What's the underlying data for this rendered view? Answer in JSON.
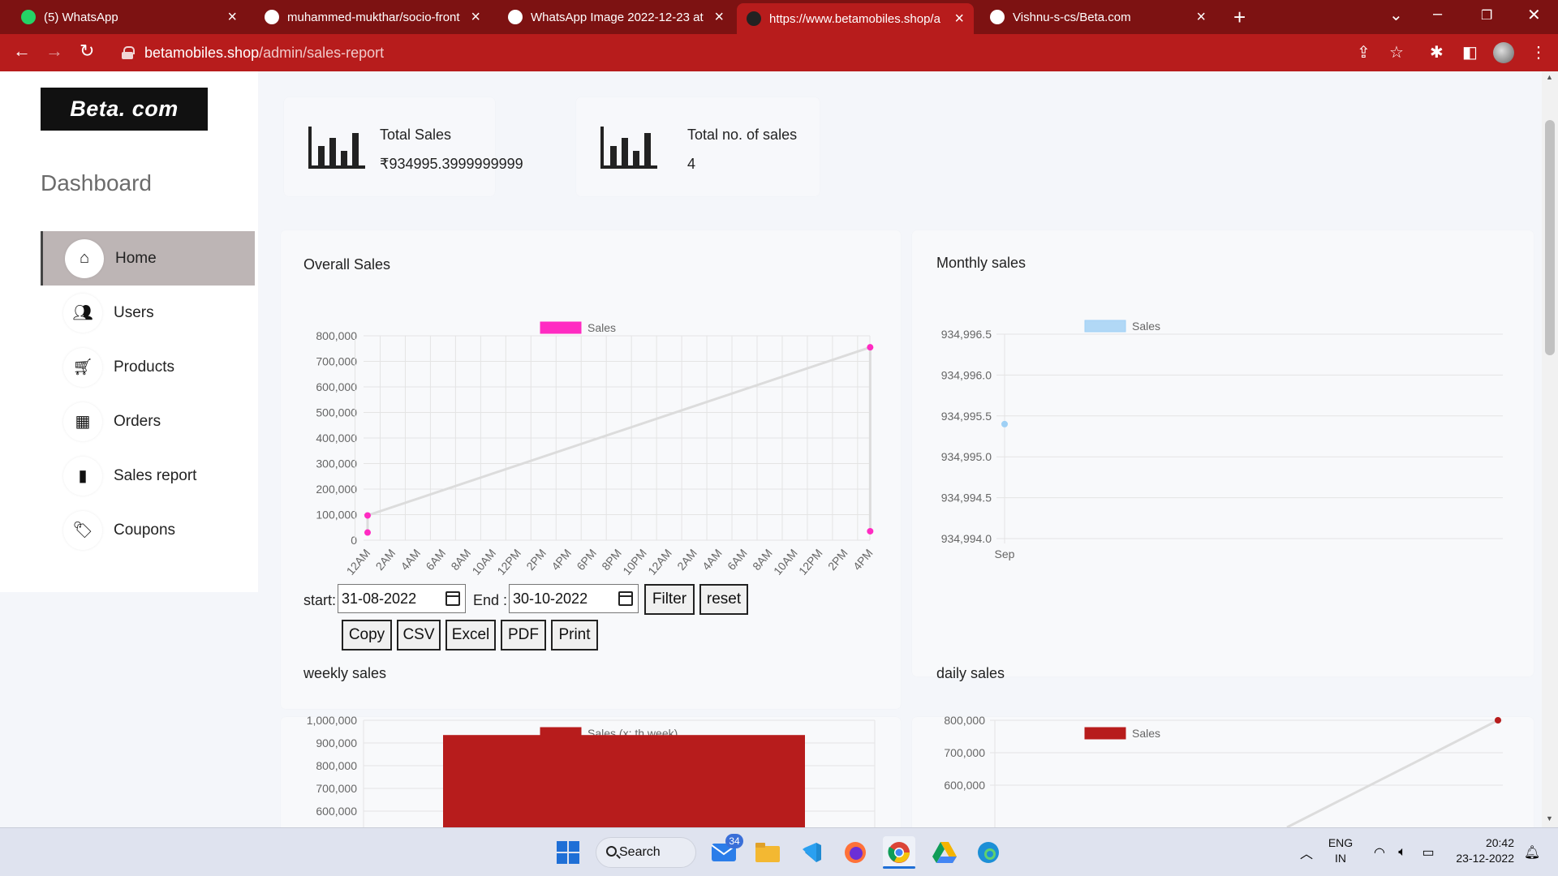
{
  "browser": {
    "tabs": [
      {
        "label": "(5) WhatsApp",
        "favicon_color": "#25d366"
      },
      {
        "label": "muhammed-mukthar/socio-front",
        "favicon_color": "#ffffff"
      },
      {
        "label": "WhatsApp Image 2022-12-23 at",
        "favicon_color": "#ffffff"
      },
      {
        "label": "https://www.betamobiles.shop/a",
        "favicon_color": "#222222"
      },
      {
        "label": "Vishnu-s-cs/Beta.com",
        "favicon_color": "#ffffff"
      }
    ],
    "active_tab_index": 3,
    "address": {
      "host": "betamobiles.shop",
      "path": "/admin/sales-report"
    }
  },
  "sidebar": {
    "logo": "Beta. com",
    "title": "Dashboard",
    "items": [
      {
        "label": "Home",
        "icon": "home-icon",
        "active": true
      },
      {
        "label": "Users",
        "icon": "users-icon",
        "active": false
      },
      {
        "label": "Products",
        "icon": "cart-icon",
        "active": false
      },
      {
        "label": "Orders",
        "icon": "table-icon",
        "active": false
      },
      {
        "label": "Sales report",
        "icon": "bar-chart-icon",
        "active": false
      },
      {
        "label": "Coupons",
        "icon": "tag-icon",
        "active": false
      }
    ]
  },
  "stats": {
    "total_sales_label": "Total Sales",
    "total_sales_value": "₹934995.3999999999",
    "total_count_label": "Total no. of sales",
    "total_count_value": "4"
  },
  "controls": {
    "start_label": "start:",
    "start_value": "31-08-2022",
    "end_label": "End :",
    "end_value": "30-10-2022",
    "filter_label": "Filter",
    "reset_label": "reset",
    "export_buttons": [
      "Copy",
      "CSV",
      "Excel",
      "PDF",
      "Print"
    ]
  },
  "chart_titles": {
    "overall": "Overall Sales",
    "monthly": "Monthly sales",
    "weekly": "weekly sales",
    "daily": "daily sales"
  },
  "chart_data": [
    {
      "type": "line",
      "title": "Overall Sales",
      "legend": "Sales",
      "color": "#ff2bc2",
      "x_ticks": [
        "12AM",
        "2AM",
        "4AM",
        "6AM",
        "8AM",
        "10AM",
        "12PM",
        "2PM",
        "4PM",
        "6PM",
        "8PM",
        "10PM",
        "12AM",
        "2AM",
        "4AM",
        "6AM",
        "8AM",
        "10AM",
        "12PM",
        "2PM",
        "4PM"
      ],
      "y_ticks": [
        "800,000",
        "700,000",
        "600,000",
        "500,000",
        "400,000",
        "300,000",
        "200,000",
        "100,000",
        "0"
      ],
      "ylim": [
        0,
        800000
      ],
      "points": [
        {
          "x": "12AM",
          "y": 30000
        },
        {
          "x": "12AM",
          "y": 97000
        },
        {
          "x": "4PM",
          "y": 755000
        },
        {
          "x": "4PM",
          "y": 35000
        }
      ]
    },
    {
      "type": "line",
      "title": "Monthly sales",
      "legend": "Sales",
      "color": "#9fd0f5",
      "x_ticks": [
        "Sep"
      ],
      "y_ticks": [
        "934,996.5",
        "934,996.0",
        "934,995.5",
        "934,995.0",
        "934,994.5",
        "934,994.0"
      ],
      "ylim": [
        934994.0,
        934996.5
      ],
      "points": [
        {
          "x": "Sep",
          "y": 934995.4
        }
      ]
    },
    {
      "type": "bar",
      "title": "weekly sales",
      "legend": "Sales (x: th week)",
      "color": "#b71c1c",
      "y_ticks": [
        "1,000,000",
        "900,000",
        "800,000",
        "700,000",
        "600,000"
      ],
      "ylim": [
        600000,
        1000000
      ],
      "values": [
        934995
      ]
    },
    {
      "type": "line",
      "title": "daily sales",
      "legend": "Sales",
      "color": "#b71c1c",
      "y_ticks": [
        "800,000",
        "700,000",
        "600,000"
      ],
      "ylim": [
        600000,
        800000
      ],
      "points": [
        {
          "x": 1,
          "y": 800000
        }
      ]
    }
  ],
  "taskbar": {
    "search_label": "Search",
    "mail_badge": "34",
    "lang_top": "ENG",
    "lang_bottom": "IN",
    "time": "20:42",
    "date": "23-12-2022"
  }
}
